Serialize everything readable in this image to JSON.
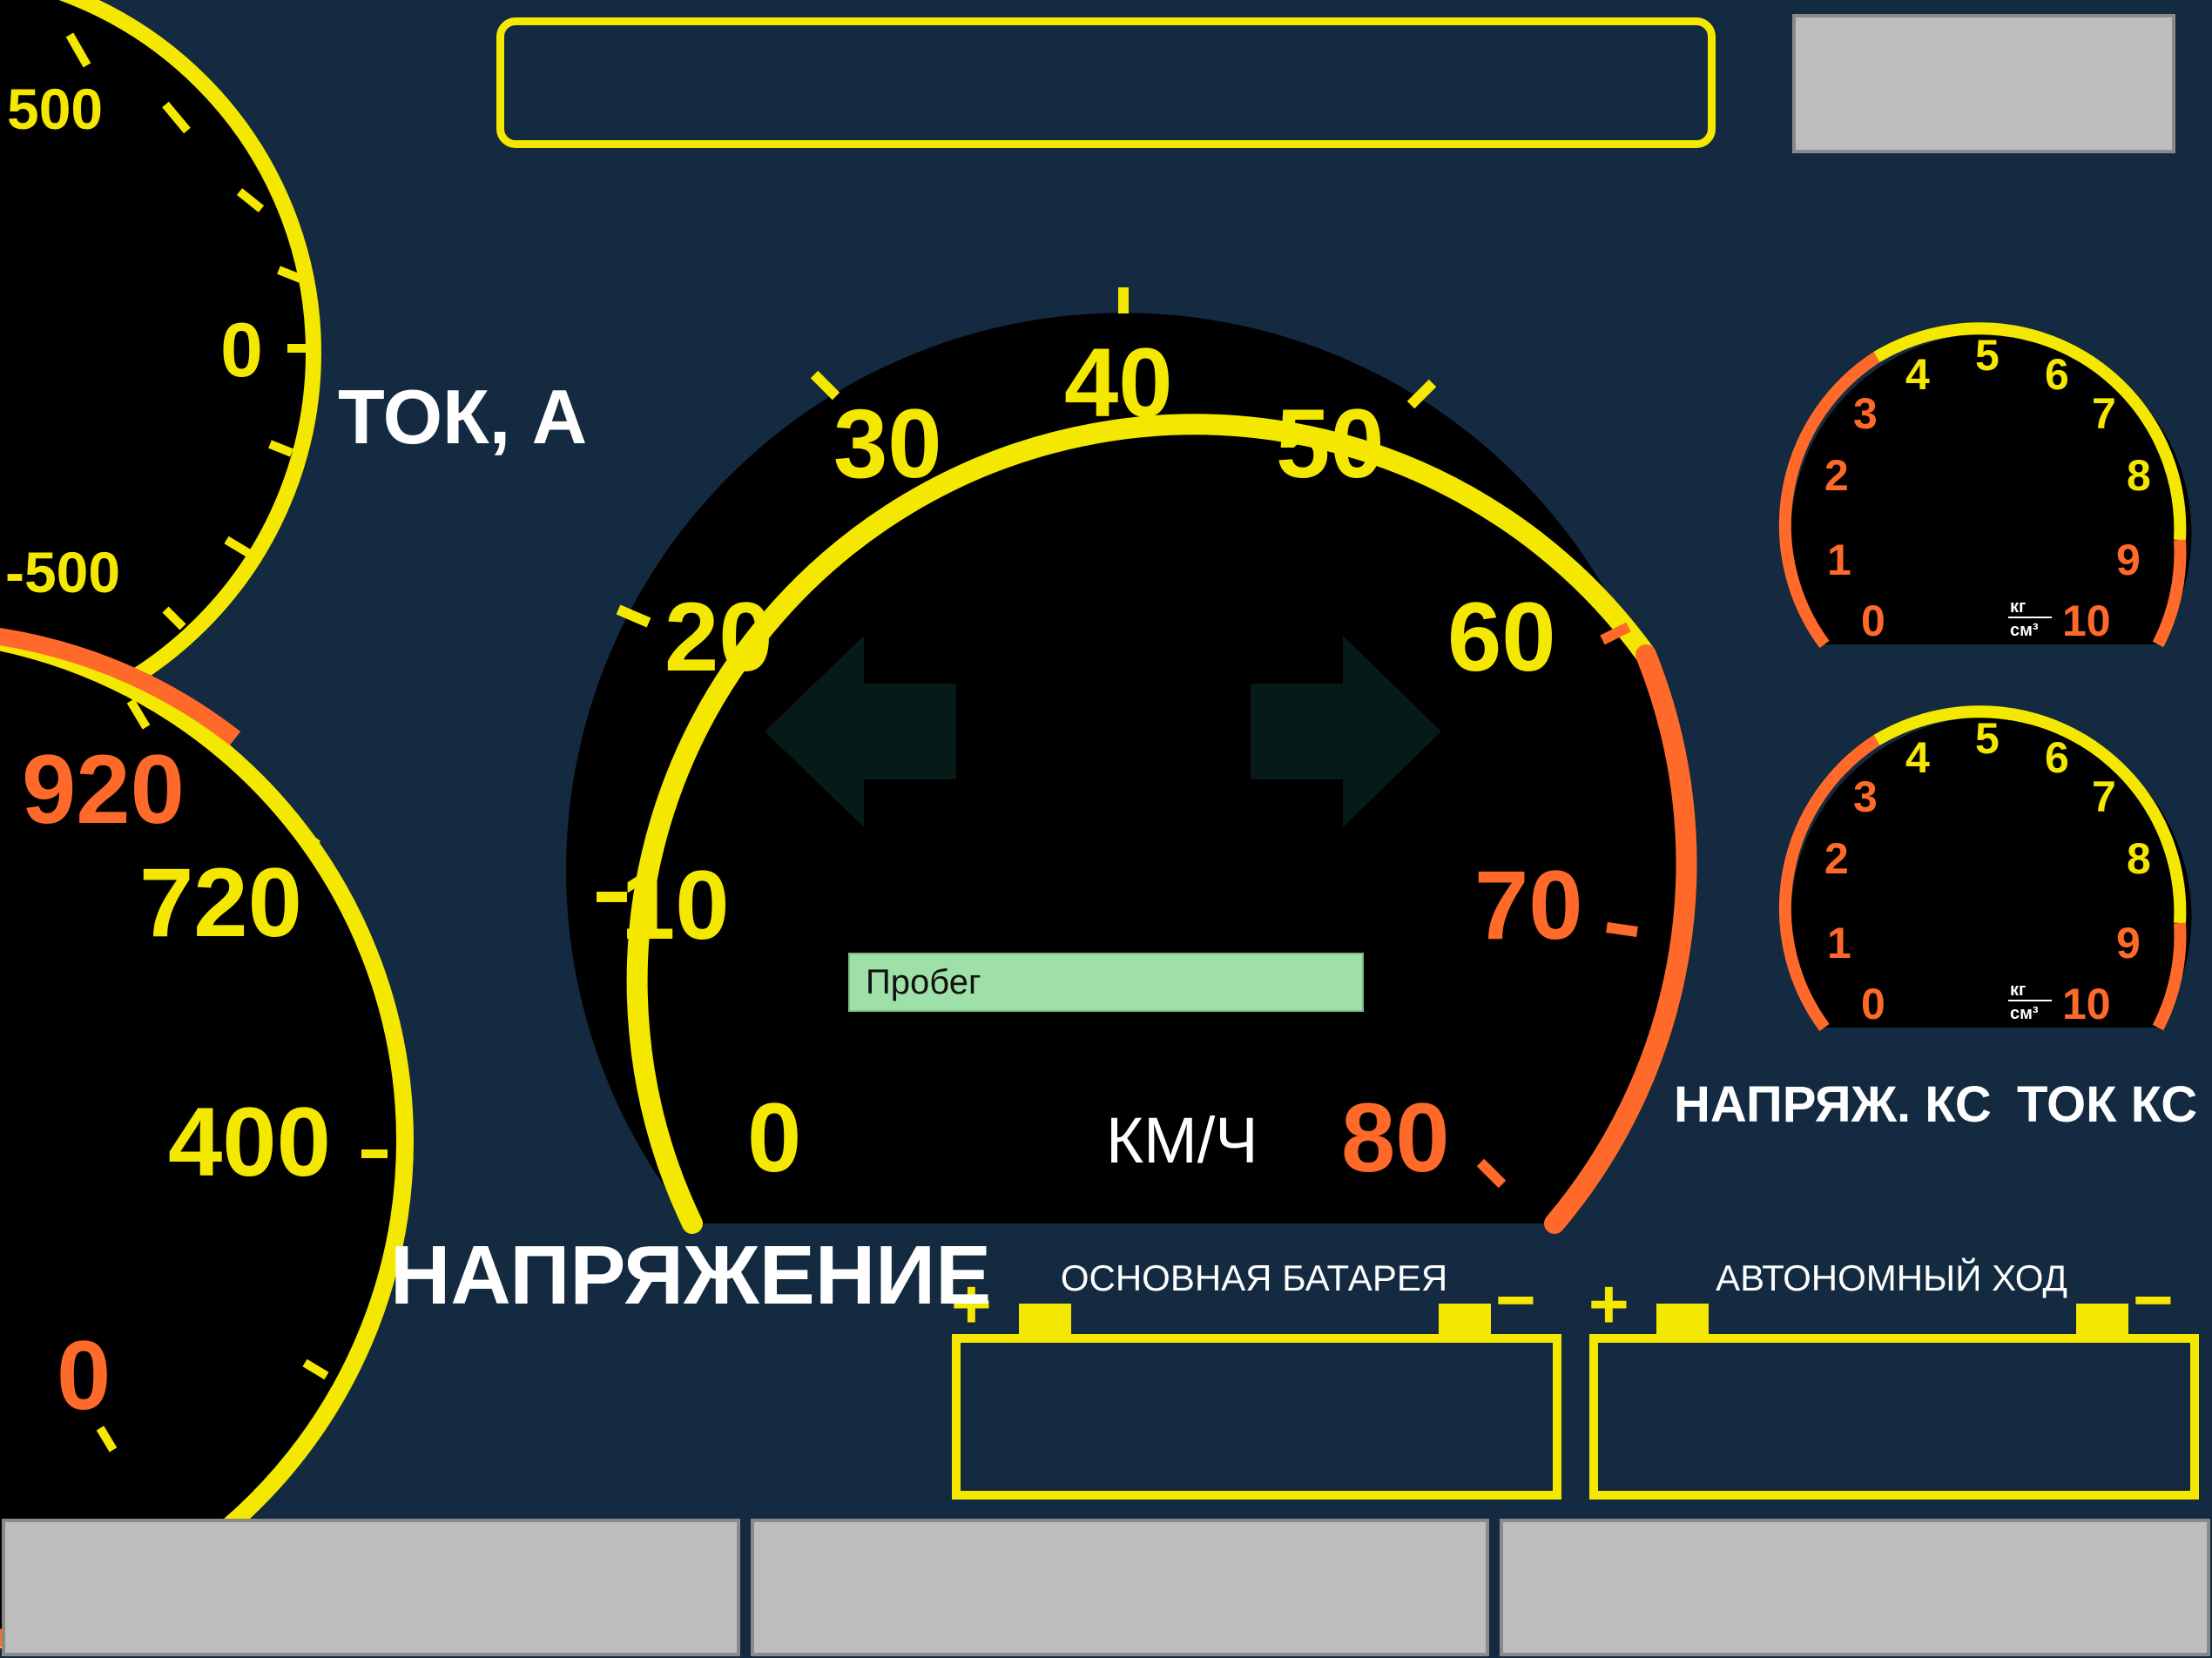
{
  "message_box": {
    "text": ""
  },
  "current_gauge": {
    "label": "ТОК, А",
    "ticks": [
      "500",
      "0",
      "-500"
    ]
  },
  "voltage_gauge": {
    "label": "НАПРЯЖЕНИЕ",
    "ticks": [
      "920",
      "720",
      "400",
      "0"
    ]
  },
  "speedometer": {
    "unit": "КМ/Ч",
    "ticks": [
      "0",
      "10",
      "20",
      "30",
      "40",
      "50",
      "60",
      "70",
      "80"
    ],
    "mileage_label": "Пробег"
  },
  "pressure_gauges": [
    {
      "label": "НАПРЯЖ. КС",
      "ticks": [
        "0",
        "1",
        "2",
        "3",
        "4",
        "5",
        "6",
        "7",
        "8",
        "9",
        "10"
      ],
      "unit_num": "кг",
      "unit_den": "см³"
    },
    {
      "label": "ТОК КС",
      "ticks": [
        "0",
        "1",
        "2",
        "3",
        "4",
        "5",
        "6",
        "7",
        "8",
        "9",
        "10"
      ],
      "unit_num": "кг",
      "unit_den": "см³"
    }
  ],
  "batteries": [
    {
      "label": "ОСНОВНАЯ БАТАРЕЯ",
      "plus": "+",
      "minus": "−"
    },
    {
      "label": "АВТОНОМНЫЙ ХОД",
      "plus": "+",
      "minus": "−"
    }
  ],
  "colors": {
    "background": "#132a40",
    "yellow": "#f5e800",
    "orange": "#ff6a2a",
    "arrow": "#061a18"
  }
}
